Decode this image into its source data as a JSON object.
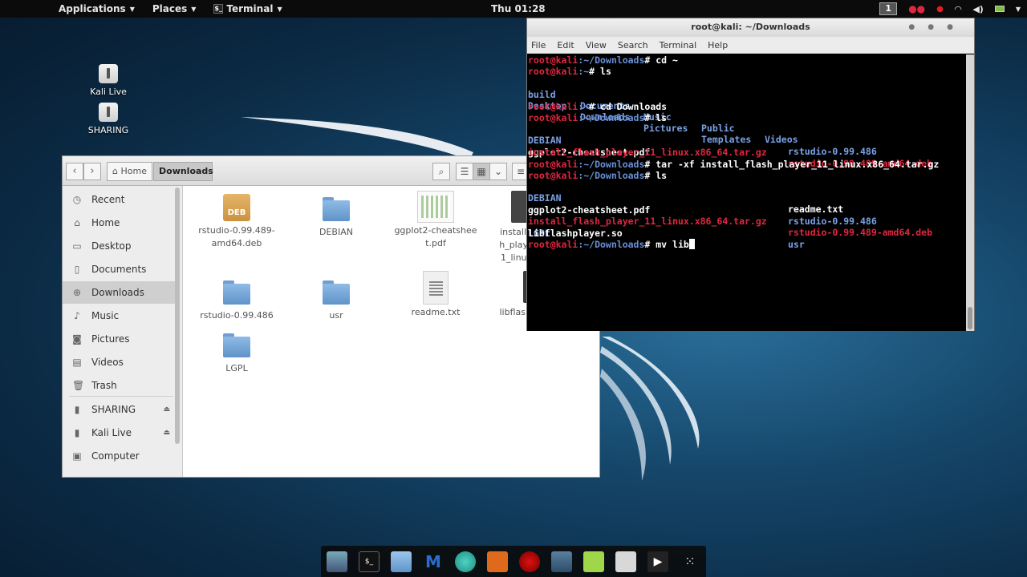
{
  "topbar": {
    "applications": "Applications",
    "places": "Places",
    "terminal": "Terminal",
    "clock": "Thu 01:28",
    "workspace": "1"
  },
  "desktop_icons": [
    {
      "label": "Kali Live"
    },
    {
      "label": "SHARING"
    }
  ],
  "file_manager": {
    "breadcrumb_home": "Home",
    "breadcrumb_current": "Downloads",
    "sidebar": [
      {
        "label": "Recent",
        "icon": "clock-icon"
      },
      {
        "label": "Home",
        "icon": "home-icon"
      },
      {
        "label": "Desktop",
        "icon": "desktop-icon"
      },
      {
        "label": "Documents",
        "icon": "document-icon"
      },
      {
        "label": "Downloads",
        "icon": "download-icon"
      },
      {
        "label": "Music",
        "icon": "music-icon"
      },
      {
        "label": "Pictures",
        "icon": "camera-icon"
      },
      {
        "label": "Videos",
        "icon": "film-icon"
      },
      {
        "label": "Trash",
        "icon": "trash-icon"
      },
      {
        "label": "SHARING",
        "icon": "usb-drive-icon"
      },
      {
        "label": "Kali Live",
        "icon": "usb-drive-icon"
      },
      {
        "label": "Computer",
        "icon": "computer-icon"
      }
    ],
    "files": [
      {
        "name": "rstudio-0.99.489-amd64.deb",
        "type": "deb",
        "badge": "DEB"
      },
      {
        "name": "DEBIAN",
        "type": "folder"
      },
      {
        "name": "ggplot2-cheatsheet.pdf",
        "type": "pdf"
      },
      {
        "name": "install_flash_player_11_linux.x86_64.tar.gz",
        "type": "archive"
      },
      {
        "name": "rstudio-0.99.486",
        "type": "folder"
      },
      {
        "name": "usr",
        "type": "folder"
      },
      {
        "name": "readme.txt",
        "type": "txt"
      },
      {
        "name": "libflashplayer.so",
        "type": "so"
      },
      {
        "name": "LGPL",
        "type": "folder"
      }
    ]
  },
  "terminal": {
    "title": "root@kali: ~/Downloads",
    "menu": [
      "File",
      "Edit",
      "View",
      "Search",
      "Terminal",
      "Help"
    ],
    "prompt_user": "root@kali",
    "lines": {
      "l1_path": ":~/Downloads",
      "l1_cmd": "# cd ~",
      "l2_path": ":~",
      "l2_cmd": "# ls",
      "ls_home_row1": [
        "build",
        "Documents",
        "Music",
        "Public",
        "Videos"
      ],
      "ls_home_row2": [
        "Desktop",
        "Downloads",
        "Pictures",
        "Templates"
      ],
      "l5_path": ":~",
      "l5_cmd": "# cd Downloads",
      "l6_path": ":~/Downloads",
      "l6_cmd": "# ls",
      "dl1_left": "DEBIAN",
      "dl1_right": "rstudio-0.99.486",
      "dl2_left": "ggplot2-cheatsheet.pdf",
      "dl2_right": "rstudio-0.99.489-amd64.deb",
      "dl3_left": "install_flash_player_11_linux.x86_64.tar.gz",
      "l10_path": ":~/Downloads",
      "l10_cmd": "# tar -xf install_flash_player_11_linux.x86_64.tar.gz",
      "l11_path": ":~/Downloads",
      "l11_cmd": "# ls",
      "dl4_left": "DEBIAN",
      "dl4_right": "readme.txt",
      "dl5_left": "ggplot2-cheatsheet.pdf",
      "dl5_right": "rstudio-0.99.486",
      "dl6_left": "install_flash_player_11_linux.x86_64.tar.gz",
      "dl6_right": "rstudio-0.99.489-amd64.deb",
      "dl7_left": "LGPL",
      "dl7_right": "usr",
      "dl8_left": "libflashplayer.so",
      "l17_path": ":~/Downloads",
      "l17_cmd": "# mv lib"
    }
  },
  "dock": {
    "items": [
      "finder-icon",
      "terminal-icon",
      "files-icon",
      "metasploit-icon",
      "armitage-icon",
      "burpsuite-icon",
      "faraday-icon",
      "maltego-icon",
      "leafpad-icon",
      "screenshot-icon",
      "media-player-icon",
      "app-grid-icon"
    ]
  },
  "colors": {
    "prompt": "#e0263f",
    "directory": "#7aa2e6",
    "archive": "#e0263f"
  }
}
